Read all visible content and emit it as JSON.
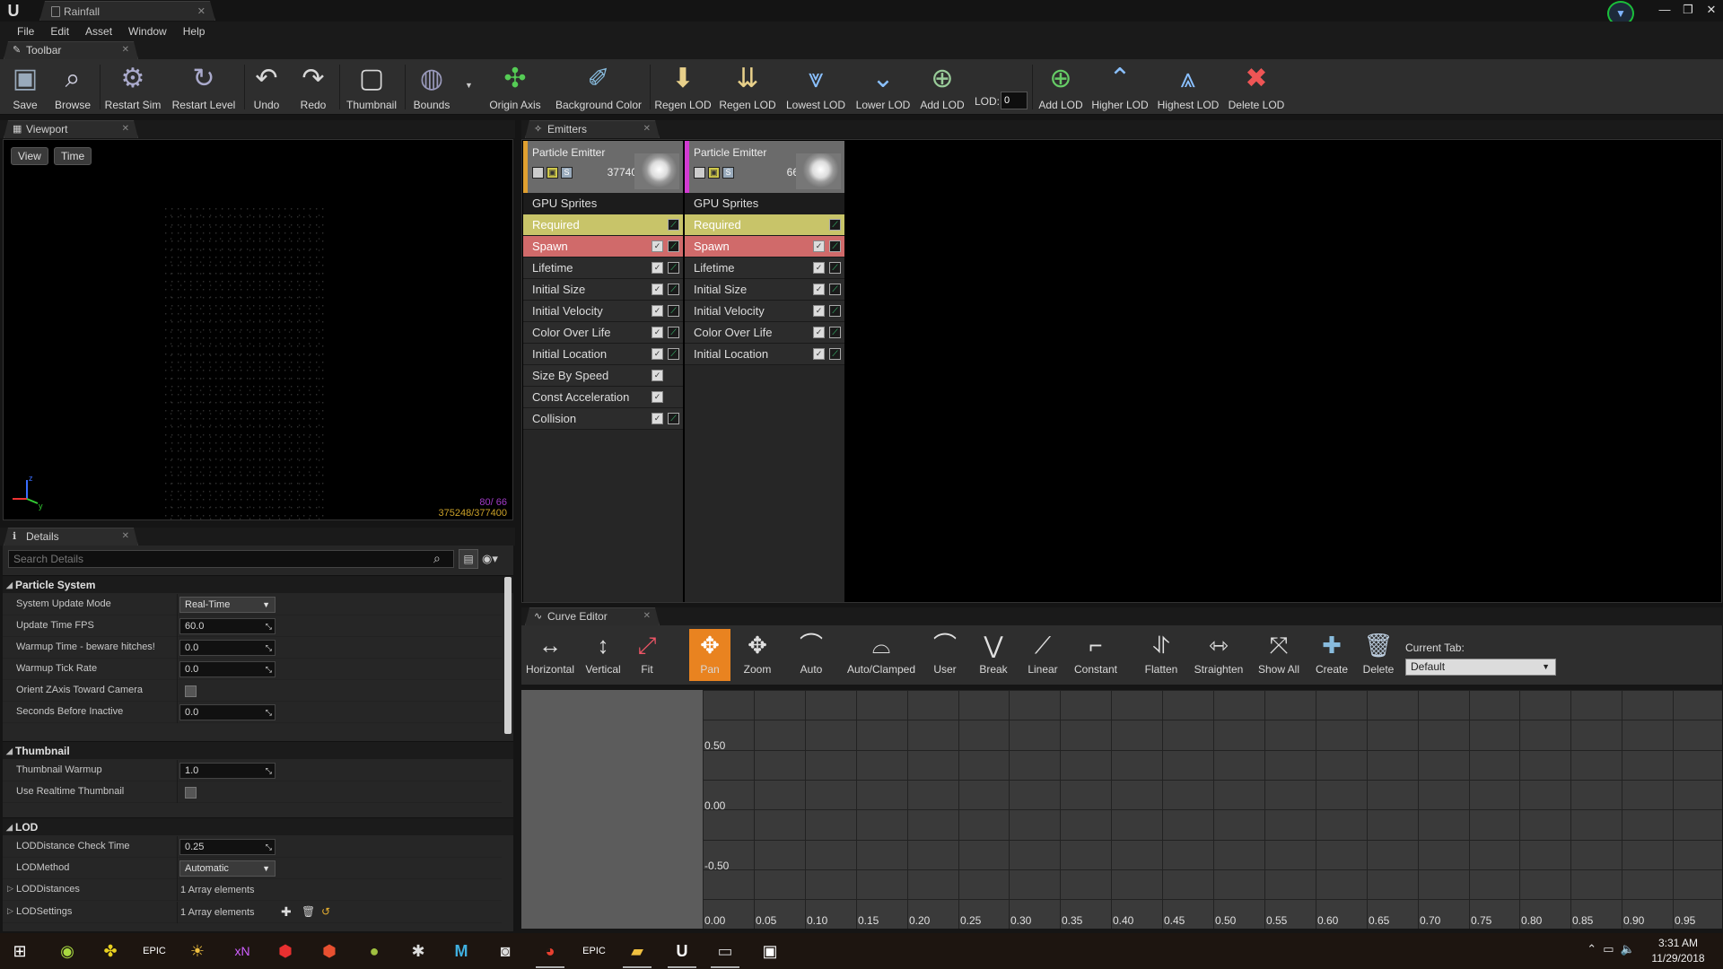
{
  "window": {
    "tab_title": "Rainfall",
    "minimize": "—",
    "maximize": "❐",
    "close": "✕"
  },
  "menu": [
    "File",
    "Edit",
    "Asset",
    "Window",
    "Help"
  ],
  "panels": {
    "toolbar": "Toolbar",
    "viewport": "Viewport",
    "details": "Details",
    "emitters": "Emitters",
    "curve_editor": "Curve Editor"
  },
  "toolbar": {
    "buttons": [
      "Save",
      "Browse",
      "Restart Sim",
      "Restart Level",
      "Undo",
      "Redo",
      "Thumbnail",
      "Bounds",
      "Origin Axis",
      "Background Color",
      "Regen LOD",
      "Regen LOD",
      "Lowest LOD",
      "Lower LOD",
      "Add LOD",
      "Add LOD",
      "Higher LOD",
      "Highest LOD",
      "Delete LOD"
    ],
    "lod_label": "LOD:",
    "lod_value": "0"
  },
  "viewport": {
    "view_btn": "View",
    "time_btn": "Time",
    "stats_line1": "80/ 66",
    "stats_line2": "375248/377400"
  },
  "details": {
    "search_placeholder": "Search Details",
    "cat_particle": "Particle System",
    "system_update_mode_label": "System Update Mode",
    "system_update_mode_value": "Real-Time",
    "update_fps_label": "Update Time FPS",
    "update_fps_value": "60.0",
    "warmup_time_label": "Warmup Time - beware hitches!",
    "warmup_time_value": "0.0",
    "warmup_tick_label": "Warmup Tick Rate",
    "warmup_tick_value": "0.0",
    "orient_z_label": "Orient ZAxis Toward Camera",
    "seconds_inactive_label": "Seconds Before Inactive",
    "seconds_inactive_value": "0.0",
    "cat_thumbnail": "Thumbnail",
    "thumb_warmup_label": "Thumbnail Warmup",
    "thumb_warmup_value": "1.0",
    "realtime_thumb_label": "Use Realtime Thumbnail",
    "cat_lod": "LOD",
    "lod_check_label": "LODDistance Check Time",
    "lod_check_value": "0.25",
    "lod_method_label": "LODMethod",
    "lod_method_value": "Automatic",
    "lod_distances_label": "LODDistances",
    "lod_distances_value": "1 Array elements",
    "lod_settings_label": "LODSettings",
    "lod_settings_value": "1 Array elements"
  },
  "emitters": [
    {
      "title": "Particle Emitter",
      "count": "37740",
      "type": "GPU Sprites",
      "modules": [
        "Required",
        "Spawn",
        "Lifetime",
        "Initial Size",
        "Initial Velocity",
        "Color Over Life",
        "Initial Location",
        "Size By Speed",
        "Const Acceleration",
        "Collision"
      ]
    },
    {
      "title": "Particle Emitter",
      "count": "66",
      "type": "GPU Sprites",
      "modules": [
        "Required",
        "Spawn",
        "Lifetime",
        "Initial Size",
        "Initial Velocity",
        "Color Over Life",
        "Initial Location"
      ]
    }
  ],
  "curve_editor": {
    "buttons": [
      "Horizontal",
      "Vertical",
      "Fit",
      "Pan",
      "Zoom",
      "Auto",
      "Auto/Clamped",
      "User",
      "Break",
      "Linear",
      "Constant",
      "Flatten",
      "Straighten",
      "Show All",
      "Create",
      "Delete"
    ],
    "current_tab_label": "Current Tab:",
    "current_tab_value": "Default",
    "y_labels": [
      "0.50",
      "0.00",
      "-0.50"
    ],
    "x_labels": [
      "0.00",
      "0.05",
      "0.10",
      "0.15",
      "0.20",
      "0.25",
      "0.30",
      "0.35",
      "0.40",
      "0.45",
      "0.50",
      "0.55",
      "0.60",
      "0.65",
      "0.70",
      "0.75",
      "0.80",
      "0.85",
      "0.90",
      "0.95"
    ]
  },
  "taskbar": {
    "time": "3:31 AM",
    "date": "11/29/2018"
  }
}
